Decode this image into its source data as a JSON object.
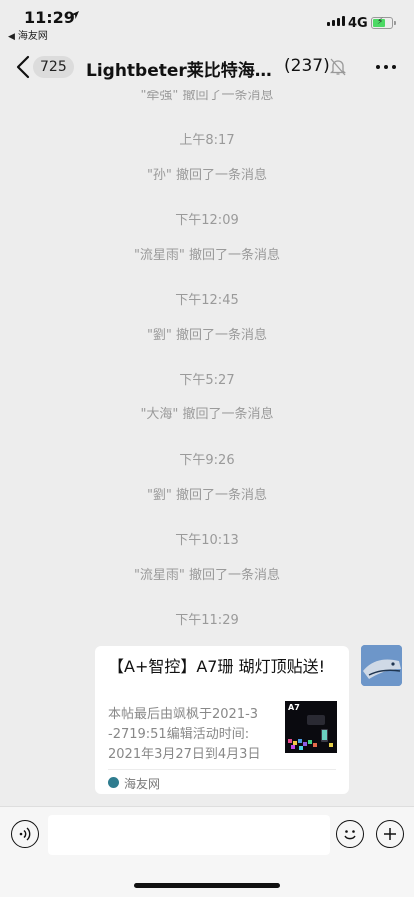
{
  "status_bar": {
    "time": "11:29",
    "back_app": "海友网",
    "network": "4G"
  },
  "nav": {
    "unread_count": "725",
    "title": "Lightbeter莱比特海缸灯官方群",
    "member_count": "(237)",
    "icons": [
      "back-chevron-icon",
      "mute-bell-icon",
      "more-icon"
    ]
  },
  "chat": {
    "system_messages": [
      {
        "text": "\"牵强\" 撤回了一条消息"
      },
      {
        "text": "上午8:17"
      },
      {
        "text": "\"孙\" 撤回了一条消息"
      },
      {
        "text": "下午12:09"
      },
      {
        "text": "\"流星雨\" 撤回了一条消息"
      },
      {
        "text": "下午12:45"
      },
      {
        "text": "\"劉\" 撤回了一条消息"
      },
      {
        "text": "下午5:27"
      },
      {
        "text": "\"大海\" 撤回了一条消息"
      },
      {
        "text": "下午9:26"
      },
      {
        "text": "\"劉\" 撤回了一条消息"
      },
      {
        "text": "下午10:13"
      },
      {
        "text": "\"流星雨\" 撤回了一条消息"
      },
      {
        "text": "下午11:29"
      }
    ],
    "link_card": {
      "title": "【A+智控】A7珊 瑚灯顶贴送!",
      "desc_lines": [
        "本帖最后由飒枫于2021-3",
        "-2719:51编辑活动时间:",
        "2021年3月27日到4月3日"
      ],
      "thumb_label": "A7",
      "source": "海友网"
    }
  },
  "input_bar": {
    "icons": [
      "voice-icon",
      "emoji-icon",
      "plus-icon"
    ]
  }
}
